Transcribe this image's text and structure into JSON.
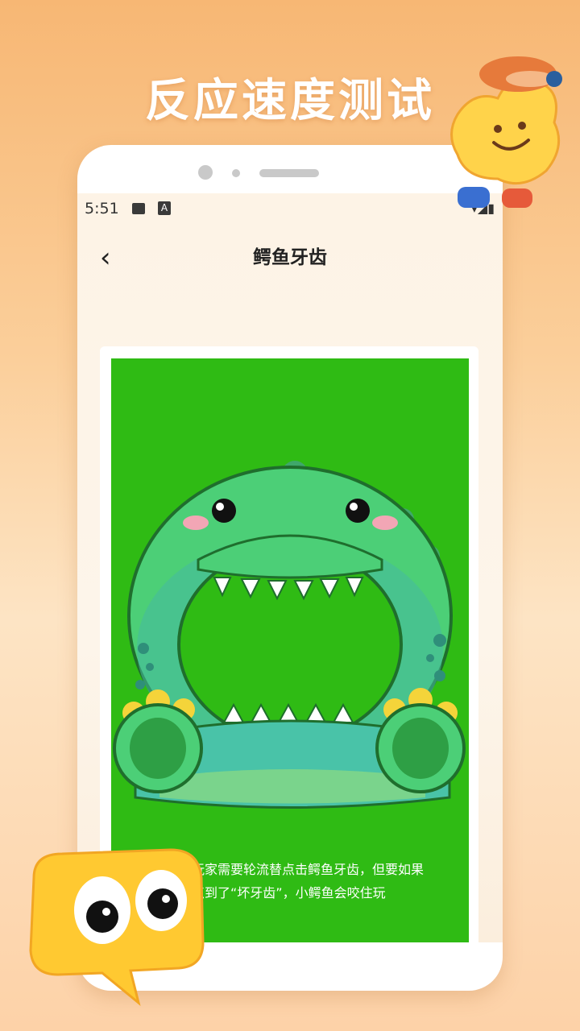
{
  "promo": {
    "headline": "反应速度测试"
  },
  "status_bar": {
    "time": "5:51",
    "icons": [
      "image-icon",
      "a-icon",
      "wifi-icon",
      "signal-icon",
      "battery-icon"
    ]
  },
  "nav": {
    "title": "鳄鱼牙齿",
    "back_icon": "chevron-left-icon"
  },
  "game": {
    "description": "玩家需要轮流替点击鳄鱼牙齿，但要如果点到了“坏牙齿”，小鳄鱼会咬住玩"
  },
  "colors": {
    "panel_green": "#2fbb14",
    "croc_green": "#4ccf77",
    "accent_orange": "#f7b774"
  }
}
